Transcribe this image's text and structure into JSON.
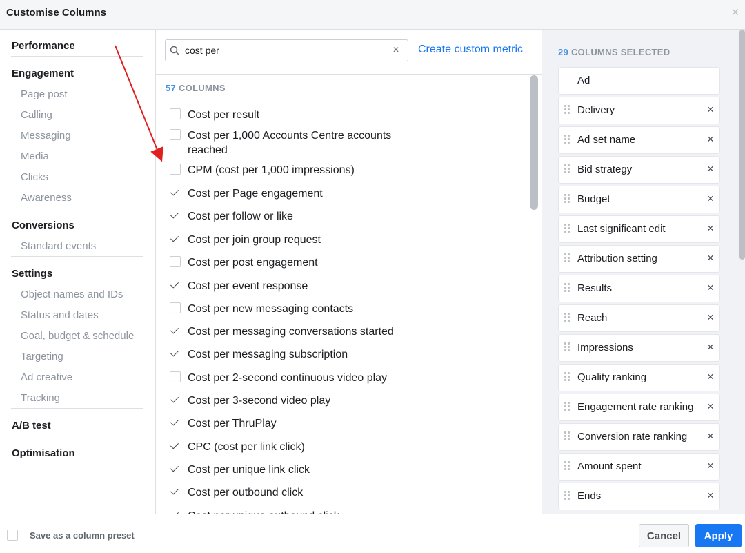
{
  "dialog": {
    "title": "Customise Columns",
    "close_icon": "close-icon"
  },
  "leftnav": {
    "groups": [
      {
        "label": "Performance",
        "items": []
      },
      {
        "label": "Engagement",
        "items": [
          "Page post",
          "Calling",
          "Messaging",
          "Media",
          "Clicks",
          "Awareness"
        ]
      },
      {
        "label": "Conversions",
        "items": [
          "Standard events"
        ]
      },
      {
        "label": "Settings",
        "items": [
          "Object names and IDs",
          "Status and dates",
          "Goal, budget & schedule",
          "Targeting",
          "Ad creative",
          "Tracking"
        ]
      },
      {
        "label": "A/B test",
        "items": []
      },
      {
        "label": "Optimisation",
        "items": []
      }
    ]
  },
  "search": {
    "value": "cost per",
    "placeholder": "Search"
  },
  "custom_metric_link": "Create custom metric",
  "columns_count": {
    "number": "57",
    "label": "COLUMNS"
  },
  "metrics": [
    {
      "label": "Cost per result",
      "checked": false
    },
    {
      "label": "Cost per 1,000 Accounts Centre accounts reached",
      "checked": false
    },
    {
      "label": "CPM (cost per 1,000 impressions)",
      "checked": false
    },
    {
      "label": "Cost per Page engagement",
      "checked": true
    },
    {
      "label": "Cost per follow or like",
      "checked": true
    },
    {
      "label": "Cost per join group request",
      "checked": true
    },
    {
      "label": "Cost per post engagement",
      "checked": false
    },
    {
      "label": "Cost per event response",
      "checked": true
    },
    {
      "label": "Cost per new messaging contacts",
      "checked": false
    },
    {
      "label": "Cost per messaging conversations started",
      "checked": true
    },
    {
      "label": "Cost per messaging subscription",
      "checked": true
    },
    {
      "label": "Cost per 2-second continuous video play",
      "checked": false
    },
    {
      "label": "Cost per 3-second video play",
      "checked": true
    },
    {
      "label": "Cost per ThruPlay",
      "checked": true
    },
    {
      "label": "CPC (cost per link click)",
      "checked": true
    },
    {
      "label": "Cost per unique link click",
      "checked": true
    },
    {
      "label": "Cost per outbound click",
      "checked": true
    },
    {
      "label": "Cost per unique outbound click",
      "checked": true
    }
  ],
  "selected_count": {
    "number": "29",
    "label": "COLUMNS SELECTED"
  },
  "selected": [
    {
      "label": "Ad",
      "fixed": true
    },
    {
      "label": "Delivery"
    },
    {
      "label": "Ad set name"
    },
    {
      "label": "Bid strategy"
    },
    {
      "label": "Budget"
    },
    {
      "label": "Last significant edit"
    },
    {
      "label": "Attribution setting"
    },
    {
      "label": "Results"
    },
    {
      "label": "Reach"
    },
    {
      "label": "Impressions"
    },
    {
      "label": "Quality ranking"
    },
    {
      "label": "Engagement rate ranking"
    },
    {
      "label": "Conversion rate ranking"
    },
    {
      "label": "Amount spent"
    },
    {
      "label": "Ends"
    }
  ],
  "footer": {
    "preset_label": "Save as a column preset",
    "cancel_label": "Cancel",
    "apply_label": "Apply"
  },
  "colors": {
    "accent": "#1877f2",
    "annotation_arrow": "#e02020"
  }
}
